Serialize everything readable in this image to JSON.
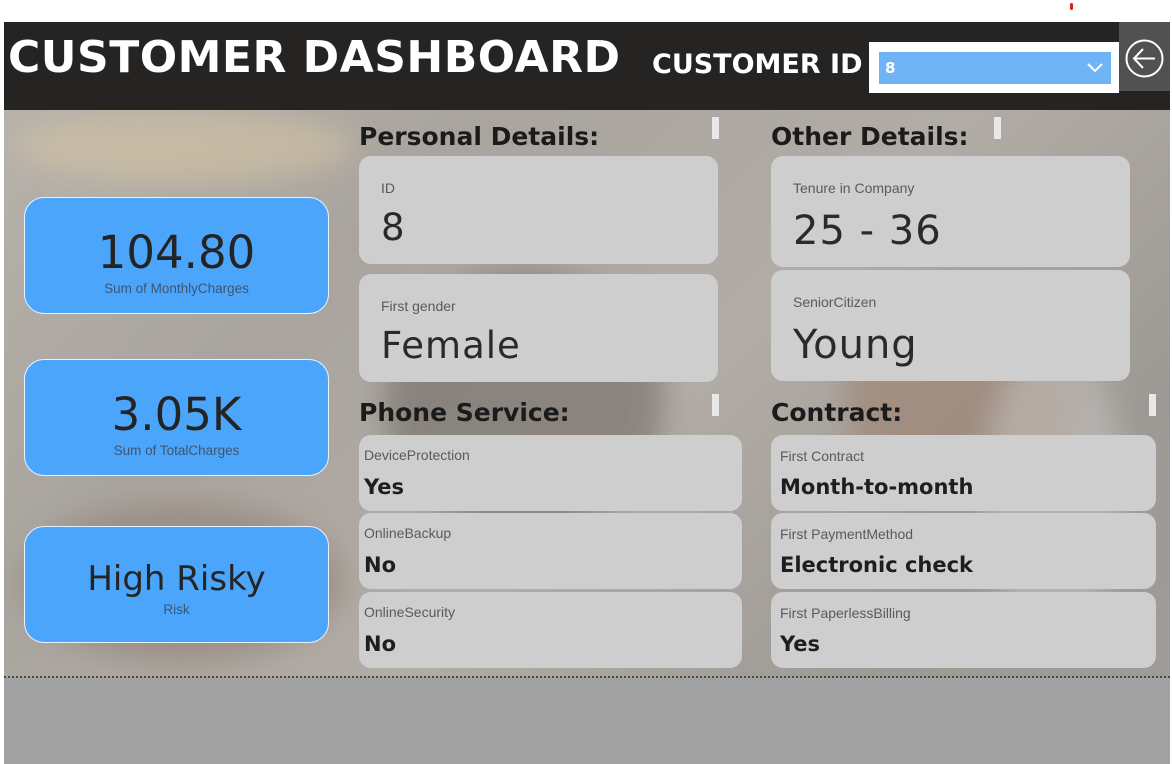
{
  "header": {
    "title": "CUSTOMER DASHBOARD",
    "customer_id_label": "CUSTOMER ID",
    "customer_id_value": "8"
  },
  "kpis": [
    {
      "value": "104.80",
      "label": "Sum of MonthlyCharges"
    },
    {
      "value": "3.05K",
      "label": "Sum of TotalCharges"
    },
    {
      "value": "High Risky",
      "label": "Risk"
    }
  ],
  "personal": {
    "heading": "Personal Details:",
    "id_label": "ID",
    "id_value": "8",
    "gender_label": "First gender",
    "gender_value": "Female"
  },
  "other": {
    "heading": "Other Details:",
    "tenure_label": "Tenure in Company",
    "tenure_value": "25 - 36",
    "senior_label": "SeniorCitizen",
    "senior_value": "Young"
  },
  "phone": {
    "heading": "Phone Service:",
    "items": [
      {
        "label": "DeviceProtection",
        "value": "Yes"
      },
      {
        "label": "OnlineBackup",
        "value": "No"
      },
      {
        "label": "OnlineSecurity",
        "value": "No"
      }
    ]
  },
  "contract": {
    "heading": "Contract:",
    "items": [
      {
        "label": "First Contract",
        "value": "Month-to-month"
      },
      {
        "label": "First PaymentMethod",
        "value": "Electronic check"
      },
      {
        "label": "First PaperlessBilling",
        "value": "Yes"
      }
    ]
  },
  "colors": {
    "header_bg": "#252423",
    "kpi_blue": "#4ba6fb",
    "slicer_blue": "#6fb4f5",
    "card_gray": "#cecece"
  },
  "icons": [
    "chevron-down-icon",
    "back-arrow-icon"
  ]
}
